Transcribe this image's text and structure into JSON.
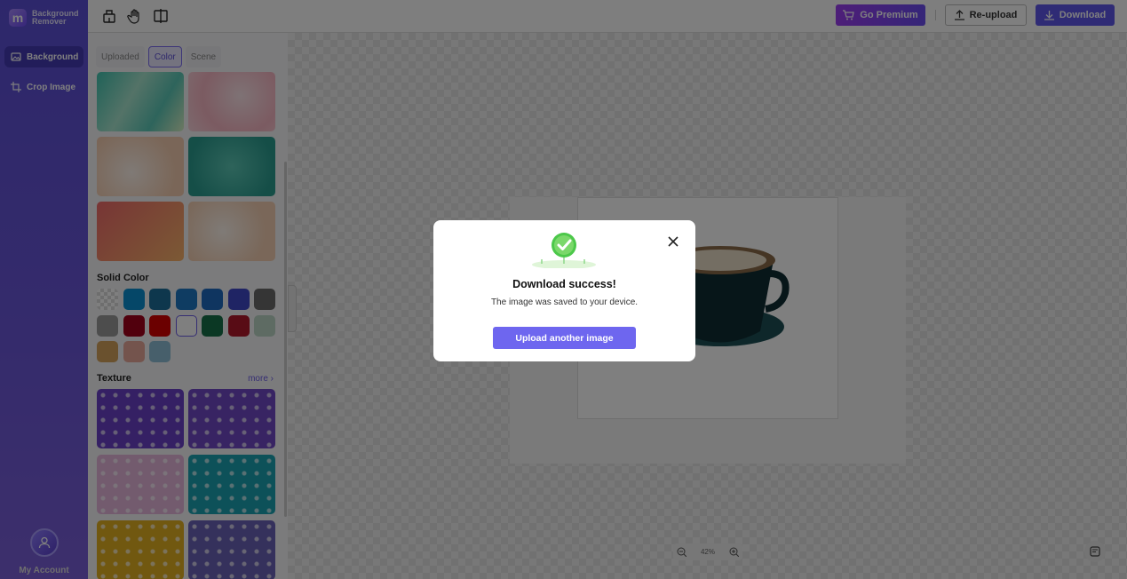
{
  "app": {
    "logo_line1": "Background",
    "logo_line2": "Remover"
  },
  "sidebar": {
    "items": [
      {
        "label": "Background",
        "icon": "image-icon",
        "active": true
      },
      {
        "label": "Crop Image",
        "icon": "crop-icon",
        "active": false
      }
    ],
    "account_label": "My Account"
  },
  "toolbar": {
    "tools": [
      "eraser-icon",
      "hand-icon",
      "compare-icon"
    ],
    "premium_label": "Go Premium",
    "reupload_label": "Re-upload",
    "download_label": "Download"
  },
  "panel": {
    "tabs": [
      {
        "label": "Uploaded",
        "active": false
      },
      {
        "label": "Color",
        "active": true
      },
      {
        "label": "Scene",
        "active": false
      }
    ],
    "gradients": [
      "linear-gradient(120deg,#3fc4b0,#a8e6cf 40%,#5cc9b8 70%,#d9f2c5)",
      "radial-gradient(circle at 60% 40%,#fde5ea,#f7b6c3 60%,#fad4dc)",
      "radial-gradient(circle at 40% 60%,#fff4ec,#f5cdb0 70%)",
      "radial-gradient(circle at 50% 50%,#5cc7b5,#2a9c8f 80%)",
      "linear-gradient(135deg,#f06a6a,#f8b46a)",
      "radial-gradient(circle at 40% 50%,#fff6ee,#f4cfb3 70%)"
    ],
    "solid_title": "Solid Color",
    "solid_colors": [
      "transparent",
      "#0a8fd1",
      "#1c6f9a",
      "#1f79c4",
      "#1f6bc0",
      "#3e49c9",
      "#6b6b6b",
      "#9a9a9a",
      "#a3001b",
      "#d60000",
      "#ffffff",
      "#167048",
      "#b0182a",
      "#bcd6c7",
      "#d4a25c",
      "#e8a99b",
      "#8fbfd6"
    ],
    "selected_color_index": 10,
    "texture_title": "Texture",
    "more_label": "more ›",
    "textures": [
      "#6a40c8",
      "#7048c7",
      "#e7b7dd",
      "#1aa3b3",
      "#e3b020",
      "#6b62b8"
    ]
  },
  "canvas": {
    "zoom_label": "42%"
  },
  "modal": {
    "title": "Download success!",
    "message": "The image was saved to your device.",
    "button_label": "Upload another image"
  }
}
